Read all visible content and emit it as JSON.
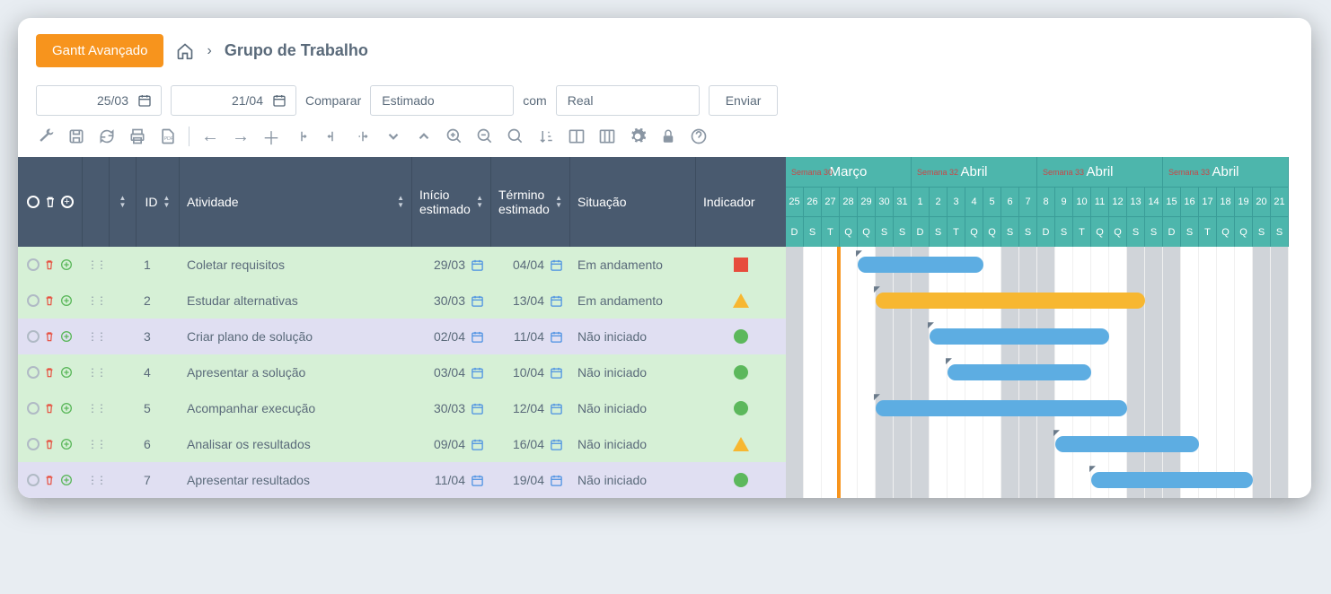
{
  "header": {
    "main_button": "Gantt Avançado",
    "breadcrumb": "Grupo de Trabalho"
  },
  "filters": {
    "date_from": "25/03",
    "date_to": "21/04",
    "compare_label": "Comparar",
    "compare_value": "Estimado",
    "with_label": "com",
    "with_value": "Real",
    "send": "Enviar"
  },
  "columns": {
    "id": "ID",
    "activity": "Atividade",
    "start": "Início estimado",
    "end": "Término estimado",
    "status": "Situação",
    "indicator": "Indicador"
  },
  "rows": [
    {
      "id": "1",
      "activity": "Coletar requisitos",
      "start": "29/03",
      "end": "04/04",
      "status": "Em andamento",
      "indicator": "square",
      "color": "green",
      "bar_start": 4,
      "bar_len": 7,
      "bar_color": "blue"
    },
    {
      "id": "2",
      "activity": "Estudar alternativas",
      "start": "30/03",
      "end": "13/04",
      "status": "Em andamento",
      "indicator": "triangle",
      "color": "green",
      "bar_start": 5,
      "bar_len": 15,
      "bar_color": "yellow"
    },
    {
      "id": "3",
      "activity": "Criar plano de solução",
      "start": "02/04",
      "end": "11/04",
      "status": "Não iniciado",
      "indicator": "circle",
      "color": "purple",
      "bar_start": 8,
      "bar_len": 10,
      "bar_color": "blue"
    },
    {
      "id": "4",
      "activity": "Apresentar a solução",
      "start": "03/04",
      "end": "10/04",
      "status": "Não iniciado",
      "indicator": "circle",
      "color": "green",
      "bar_start": 9,
      "bar_len": 8,
      "bar_color": "blue"
    },
    {
      "id": "5",
      "activity": "Acompanhar execução",
      "start": "30/03",
      "end": "12/04",
      "status": "Não iniciado",
      "indicator": "circle",
      "color": "green",
      "bar_start": 5,
      "bar_len": 14,
      "bar_color": "blue"
    },
    {
      "id": "6",
      "activity": "Analisar os resultados",
      "start": "09/04",
      "end": "16/04",
      "status": "Não iniciado",
      "indicator": "triangle",
      "color": "green",
      "bar_start": 15,
      "bar_len": 8,
      "bar_color": "blue"
    },
    {
      "id": "7",
      "activity": "Apresentar resultados",
      "start": "11/04",
      "end": "19/04",
      "status": "Não iniciado",
      "indicator": "circle",
      "color": "purple",
      "bar_start": 17,
      "bar_len": 9,
      "bar_color": "blue"
    }
  ],
  "timeline": {
    "months": [
      {
        "label": "Semana 30",
        "name": "Março",
        "days": 7
      },
      {
        "label": "Semana 32",
        "name": "Abril",
        "days": 7
      },
      {
        "label": "Semana 33",
        "name": "Abril",
        "days": 7
      },
      {
        "label": "Semana 33",
        "name": "Abril",
        "days": 7
      }
    ],
    "days": [
      "25",
      "26",
      "27",
      "28",
      "29",
      "30",
      "31",
      "1",
      "2",
      "3",
      "4",
      "5",
      "6",
      "7",
      "8",
      "9",
      "10",
      "11",
      "12",
      "13",
      "14",
      "15",
      "16",
      "17",
      "18",
      "19",
      "20",
      "21"
    ],
    "wdays": [
      "D",
      "S",
      "T",
      "Q",
      "Q",
      "S",
      "S",
      "D",
      "S",
      "T",
      "Q",
      "Q",
      "S",
      "S",
      "D",
      "S",
      "T",
      "Q",
      "Q",
      "S",
      "S",
      "D",
      "S",
      "T",
      "Q",
      "Q",
      "S",
      "S"
    ],
    "weekends": [
      0,
      5,
      6,
      7,
      12,
      13,
      14,
      19,
      20,
      21,
      26,
      27
    ]
  }
}
